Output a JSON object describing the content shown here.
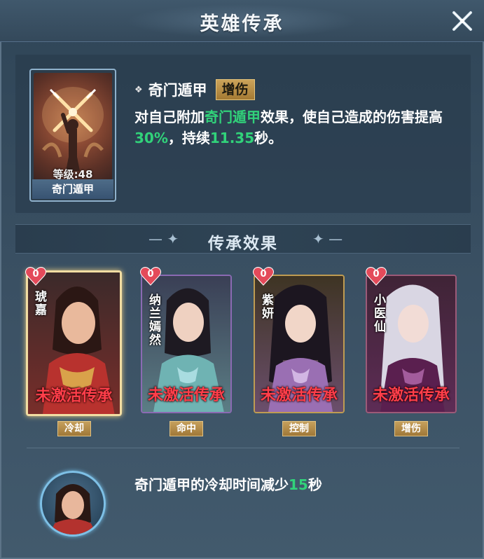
{
  "header": {
    "title": "英雄传承"
  },
  "skill": {
    "name": "奇门遁甲",
    "level_label": "等级:48",
    "card_name": "奇门遁甲",
    "tag": "增伤",
    "desc": {
      "p1": "对自己附加",
      "skill_ref": "奇门遁甲",
      "p2": "效果，使自己造成的伤害提高",
      "percent": "30%",
      "p3": "，持续",
      "duration": "11.35",
      "p4": "秒。"
    }
  },
  "effects": {
    "title": "传承效果"
  },
  "heroes": [
    {
      "name": "琥嘉",
      "hearts": "0",
      "status": "未激活传承",
      "attr": "冷却"
    },
    {
      "name": "纳兰嫣然",
      "hearts": "0",
      "status": "未激活传承",
      "attr": "命中"
    },
    {
      "name": "紫妍",
      "hearts": "0",
      "status": "未激活传承",
      "attr": "控制"
    },
    {
      "name": "小医仙",
      "hearts": "0",
      "status": "未激活传承",
      "attr": "增伤"
    }
  ],
  "bottom": {
    "p1": "奇门遁甲的冷却时间减少",
    "value": "15",
    "p2": "秒"
  },
  "colors": {
    "accent_green": "#31d27a",
    "status_red": "#ff3e4a",
    "tag_gold": "#c6a05c"
  },
  "icons": {
    "close": "close-x-icon",
    "bullet": "diamond-bullet-icon",
    "heart": "heart-icon"
  }
}
